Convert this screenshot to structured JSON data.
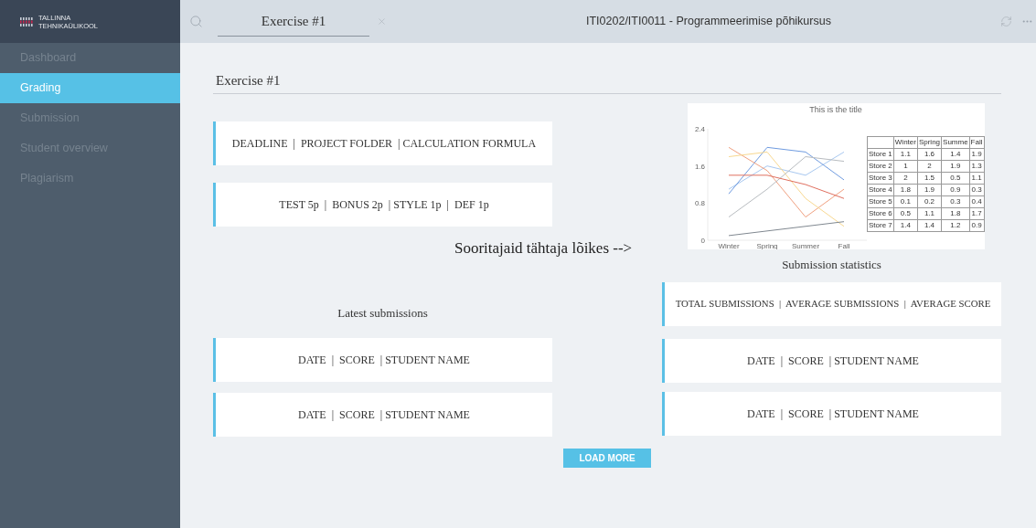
{
  "logo": {
    "line_1": "TALLINNA",
    "line_2": "TEHNIKAÜLIKOOL"
  },
  "sidebar": {
    "items": [
      {
        "label": "Dashboard",
        "selected": false
      },
      {
        "label": "Grading",
        "selected": true
      },
      {
        "label": "Submission",
        "selected": false
      },
      {
        "label": "Student overview",
        "selected": false
      },
      {
        "label": "Plagiarism",
        "selected": false
      }
    ]
  },
  "top_bar": {
    "tab": "Exercise #1",
    "course_title": "ITI0202/ITI0011 - Programmeerimise põhikursus"
  },
  "page_title": "Exercise #1",
  "info_cards": [
    "DEADLINE  |  PROJECT FOLDER  | CALCULATION FORMULA",
    "TEST 5p  |  BONUS 2p  | STYLE 1p  |  DEF 1p"
  ],
  "chart_data": {
    "type": "line",
    "title": "This is the title",
    "categories": [
      "Winter",
      "Spring",
      "Summer",
      "Fall"
    ],
    "ylim": [
      0,
      2.4
    ],
    "yticks": [
      0,
      0.8,
      1.6,
      2.4
    ],
    "series": [
      {
        "name": "Store 1",
        "color": "#a8c8f0",
        "values": [
          1.1,
          1.6,
          1.4,
          1.9
        ]
      },
      {
        "name": "Store 2",
        "color": "#6f9be0",
        "values": [
          1,
          2,
          1.9,
          1.3
        ]
      },
      {
        "name": "Store 3",
        "color": "#f0a080",
        "values": [
          2,
          1.5,
          0.5,
          1.1
        ]
      },
      {
        "name": "Store 4",
        "color": "#f8d890",
        "values": [
          1.8,
          1.9,
          0.9,
          0.3
        ]
      },
      {
        "name": "Store 5",
        "color": "#808890",
        "values": [
          0.1,
          0.2,
          0.3,
          0.4
        ]
      },
      {
        "name": "Store 6",
        "color": "#b8bcc0",
        "values": [
          0.5,
          1.1,
          1.8,
          1.7
        ]
      },
      {
        "name": "Store 7",
        "color": "#e07060",
        "values": [
          1.4,
          1.4,
          1.2,
          0.9
        ]
      }
    ]
  },
  "chart_table": {
    "columns": [
      "Winter",
      "Spring",
      "Summe",
      "Fall"
    ],
    "rows": [
      {
        "cells": [
          "1.1",
          "1.6",
          "1.4",
          "1.9"
        ]
      },
      {
        "cells": [
          "1",
          "2",
          "1.9",
          "1.3"
        ]
      },
      {
        "cells": [
          "2",
          "1.5",
          "0.5",
          "1.1"
        ]
      },
      {
        "cells": [
          "1.8",
          "1.9",
          "0.9",
          "0.3"
        ]
      },
      {
        "cells": [
          "0.1",
          "0.2",
          "0.3",
          "0.4"
        ]
      },
      {
        "cells": [
          "0.5",
          "1.1",
          "1.8",
          "1.7"
        ]
      },
      {
        "cells": [
          "1.4",
          "1.4",
          "1.2",
          "0.9"
        ]
      }
    ]
  },
  "deadline_heading": "Sooritajaid tähtaja lõikes -->",
  "latest_submissions": {
    "heading": "Latest submissions",
    "rows": [
      "DATE  |  SCORE  | STUDENT NAME",
      "DATE  |  SCORE  | STUDENT NAME"
    ]
  },
  "submission_statistics": {
    "heading": "Submission statistics",
    "summary": "TOTAL SUBMISSIONS  |  AVERAGE SUBMISSIONS  |  AVERAGE SCORE",
    "rows": [
      "DATE  |  SCORE  | STUDENT NAME",
      "DATE  |  SCORE  | STUDENT NAME"
    ]
  },
  "load_more_button": "LOAD MORE"
}
